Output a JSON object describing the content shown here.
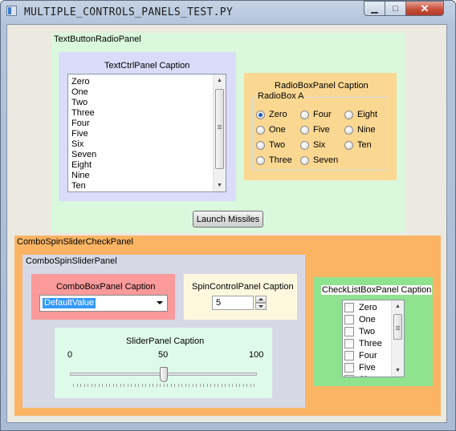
{
  "window": {
    "title": "MULTIPLE_CONTROLS_PANELS_TEST.PY",
    "minimize_glyph": "▁",
    "maximize_glyph": "□",
    "close_glyph": "✕"
  },
  "text_button_radio_panel": {
    "label": "TextButtonRadioPanel",
    "textctrl_panel": {
      "caption": "TextCtrlPanel Caption",
      "lines": [
        "Zero",
        "One",
        "Two",
        "Three",
        "Four",
        "Five",
        "Six",
        "Seven",
        "Eight",
        "Nine",
        "Ten"
      ]
    },
    "radiobox_panel": {
      "caption": "RadioBoxPanel Caption",
      "radiobox_title": "RadioBox A",
      "options": [
        {
          "label": "Zero",
          "selected": true
        },
        {
          "label": "One",
          "selected": false
        },
        {
          "label": "Two",
          "selected": false
        },
        {
          "label": "Three",
          "selected": false
        },
        {
          "label": "Four",
          "selected": false
        },
        {
          "label": "Five",
          "selected": false
        },
        {
          "label": "Six",
          "selected": false
        },
        {
          "label": "Seven",
          "selected": false
        },
        {
          "label": "Eight",
          "selected": false
        },
        {
          "label": "Nine",
          "selected": false
        },
        {
          "label": "Ten",
          "selected": false
        }
      ]
    },
    "launch_button": "Launch Missiles"
  },
  "combo_spin_slider_check_panel": {
    "label": "ComboSpinSliderCheckPanel",
    "combo_spin_slider_panel": {
      "label": "ComboSpinSliderPanel",
      "combobox_panel": {
        "caption": "ComboBoxPanel Caption",
        "value": "DefaultValue"
      },
      "spin_panel": {
        "caption": "SpinControlPanel Caption",
        "value": "5"
      },
      "slider_panel": {
        "caption": "SliderPanel Caption",
        "min_label": "0",
        "mid_label": "50",
        "max_label": "100",
        "min": 0,
        "max": 100,
        "value": 50
      }
    },
    "checklistbox_panel": {
      "caption": "CheckListBoxPanel Caption",
      "items": [
        "Zero",
        "One",
        "Two",
        "Three",
        "Four",
        "Five",
        "Six"
      ]
    }
  },
  "colors": {
    "text_button_radio_panel": "#d9f8dc",
    "textctrl_panel": "#dadcf9",
    "radiobox_panel": "#fbd892",
    "combo_spin_slider_check_panel": "#fab464",
    "combo_spin_slider_panel": "#d7d8e6",
    "combobox_panel": "#fa9a9a",
    "spin_panel": "#fef8df",
    "slider_panel": "#defbe9",
    "checklistbox_panel": "#90e38e",
    "selection": "#3399ff"
  }
}
